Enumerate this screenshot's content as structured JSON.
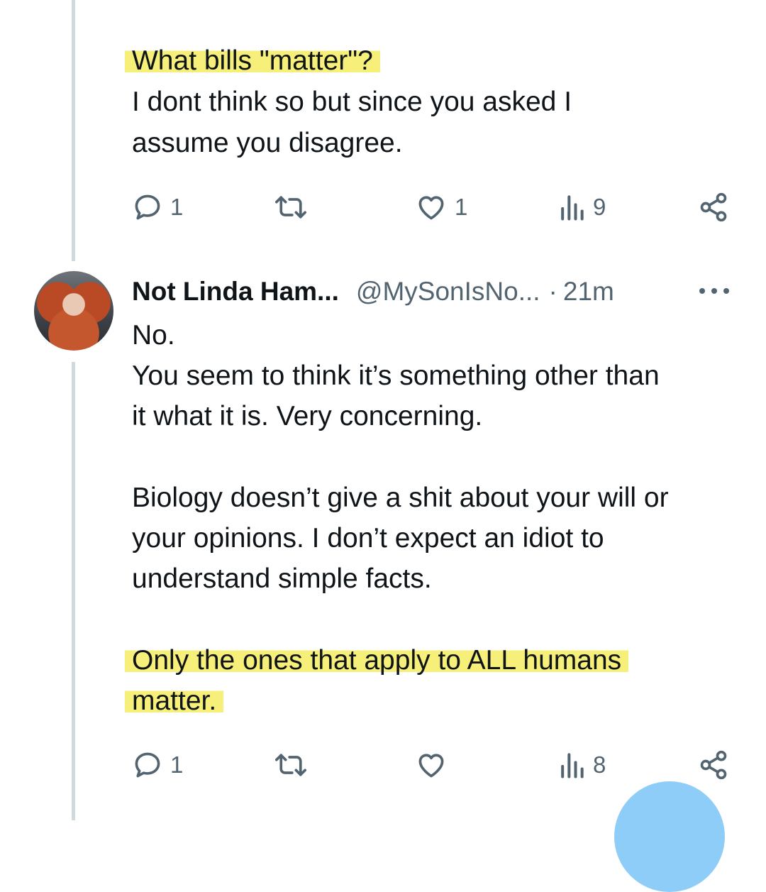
{
  "tweet_1": {
    "lines": [
      "What bills \"matter\"?",
      "I dont think so but since you asked I",
      "assume you disagree."
    ],
    "actions": {
      "replies": "1",
      "reposts": "",
      "likes": "1",
      "views": "9"
    }
  },
  "tweet_2": {
    "author_name": "Not Linda Ham...",
    "handle": "@MySonIsNo...",
    "separator": "·",
    "time": "21m",
    "lines": [
      "No.",
      "You seem to think it’s something other than",
      "it what it is. Very concerning.",
      "Biology doesn’t give a shit about your will or",
      "your opinions. I don’t expect an idiot to",
      "understand simple facts.",
      "Only the ones that apply to ALL humans",
      "matter."
    ],
    "actions": {
      "replies": "1",
      "reposts": "",
      "likes": "",
      "views": "8"
    }
  },
  "colors": {
    "highlight": "#f6f07a",
    "thread_line": "#cfd9de",
    "muted_text": "#536471",
    "fab": "#8ecdf7"
  },
  "icons": [
    "reply-icon",
    "repost-icon",
    "like-icon",
    "views-icon",
    "share-icon",
    "more-icon"
  ]
}
